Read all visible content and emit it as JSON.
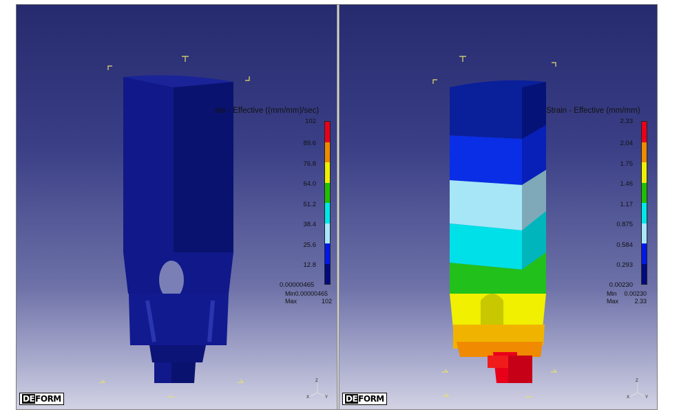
{
  "left_panel": {
    "legend_title": "ate - Effective ((mm/mm)/sec)",
    "labels": [
      "102",
      "89.6",
      "76.8",
      "64.0",
      "51.2",
      "38.4",
      "25.6",
      "12.8",
      "0.00000465"
    ],
    "min_label": "Min",
    "min_value": "0.00000465",
    "max_label": "Max",
    "max_value": "102",
    "colors": [
      "#e8001a",
      "#f08a00",
      "#f0f000",
      "#20c000",
      "#00e8e8",
      "#a8e8ff",
      "#0018e8",
      "#000a80"
    ]
  },
  "right_panel": {
    "legend_title": "Strain - Effective (mm/mm)",
    "labels": [
      "2.33",
      "2.04",
      "1.75",
      "1.46",
      "1.17",
      "0.875",
      "0.584",
      "0.293",
      "0.00230"
    ],
    "min_label": "Min",
    "min_value": "0.00230",
    "max_label": "Max",
    "max_value": "2.33",
    "colors": [
      "#e8001a",
      "#f08a00",
      "#f0f000",
      "#20c000",
      "#00e8e8",
      "#a8e8ff",
      "#0018e8",
      "#000a80"
    ]
  },
  "logo": {
    "part1": "DE",
    "part2": "FORM"
  },
  "triad": {
    "z": "Z",
    "x": "X",
    "y": "Y"
  }
}
